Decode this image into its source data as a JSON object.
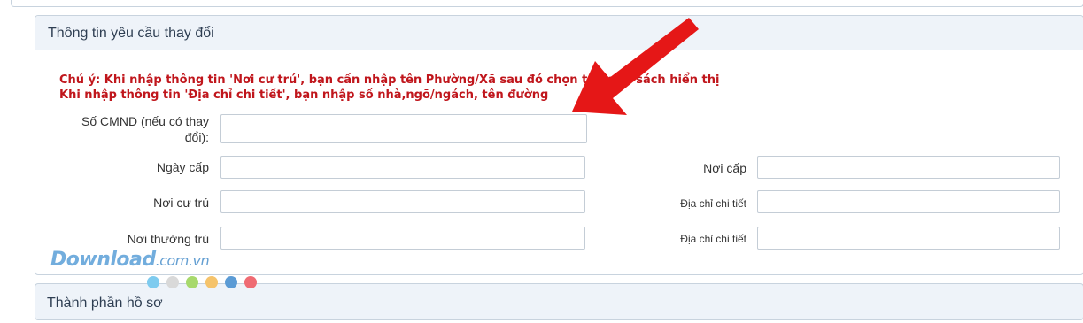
{
  "section1": {
    "title": "Thông tin yêu cầu thay đổi",
    "notice_line1": "Chú ý: Khi nhập thông tin 'Nơi cư trú', bạn cần nhập tên Phường/Xã sau đó chọn từ danh sách hiển thị",
    "notice_line2": "Khi nhập thông tin 'Địa chỉ chi tiết', bạn nhập số nhà,ngõ/ngách, tên đường"
  },
  "form": {
    "cmnd_label": "Số CMND (nếu có thay đổi):",
    "ngay_cap_label": "Ngày cấp",
    "noi_cap_label": "Nơi cấp",
    "noi_cu_tru_label": "Nơi cư trú",
    "dia_chi_label_1": "Địa chỉ chi tiết",
    "noi_thuong_tru_label": "Nơi thường trú",
    "dia_chi_label_2": "Địa chỉ chi tiết",
    "cmnd_value": "",
    "ngay_cap_value": "",
    "noi_cap_value": "",
    "noi_cu_tru_value": "",
    "dia_chi_value_1": "",
    "noi_thuong_tru_value": "",
    "dia_chi_value_2": ""
  },
  "section2": {
    "title": "Thành phần hồ sơ"
  },
  "watermark": {
    "brand": "Download",
    "domain": ".com.vn",
    "dot_colors": [
      "#7ecbef",
      "#d9d9d9",
      "#a7d96c",
      "#f5c36b",
      "#5b9bd5",
      "#ef6b73"
    ]
  },
  "colors": {
    "notice": "#c0161c",
    "header_bg": "#eef3f9",
    "border": "#c8d3de",
    "arrow": "#e51717"
  },
  "icons": {
    "annotation": "red-arrow-icon"
  }
}
